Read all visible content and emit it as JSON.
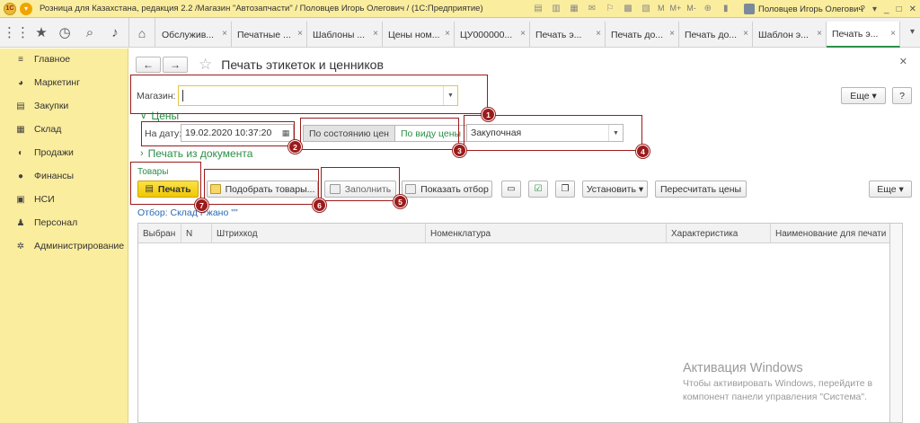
{
  "window": {
    "title": "Розница для Казахстана, редакция 2.2 /Магазин \"Автозапчасти\" / Половцев Игорь Олегович /  (1С:Предприятие)",
    "logo_text": "1С",
    "tools": [
      "M",
      "M+",
      "M-"
    ],
    "user": "Половцев Игорь Олегович",
    "controls": [
      "?",
      "▾",
      "_",
      "□",
      "✕"
    ]
  },
  "tabs": [
    {
      "label": "Обслужив...",
      "active": false
    },
    {
      "label": "Печатные ...",
      "active": false
    },
    {
      "label": "Шаблоны ...",
      "active": false
    },
    {
      "label": "Цены ном...",
      "active": false
    },
    {
      "label": "ЦУ000000...",
      "active": false
    },
    {
      "label": "Печать э...",
      "active": false
    },
    {
      "label": "Печать до...",
      "active": false
    },
    {
      "label": "Печать до...",
      "active": false
    },
    {
      "label": "Шаблон э...",
      "active": false
    },
    {
      "label": "Печать э...",
      "active": true
    }
  ],
  "sidebar": {
    "items": [
      {
        "label": "Главное",
        "icon": "menu-lines-icon"
      },
      {
        "label": "Маркетинг",
        "icon": "pie-chart-icon"
      },
      {
        "label": "Закупки",
        "icon": "cart-icon"
      },
      {
        "label": "Склад",
        "icon": "warehouse-icon"
      },
      {
        "label": "Продажи",
        "icon": "sales-icon"
      },
      {
        "label": "Финансы",
        "icon": "coins-icon"
      },
      {
        "label": "НСИ",
        "icon": "database-icon"
      },
      {
        "label": "Персонал",
        "icon": "person-icon"
      },
      {
        "label": "Администрирование",
        "icon": "gear-icon"
      }
    ]
  },
  "form": {
    "title": "Печать этикеток и ценников",
    "more_label": "Еще",
    "help_label": "?",
    "store_label": "Магазин:",
    "store_value": "",
    "prices_section": "Цены",
    "date_label": "На дату:",
    "date_value": "19.02.2020 10:37:20",
    "mode_by_state": "По состоянию цен",
    "mode_by_type": "По виду цены",
    "price_type_value": "Закупочная",
    "print_from_doc": "Печать из документа",
    "goods_group": "Товары",
    "toolbar": {
      "print": "Печать",
      "pick_goods": "Подобрать товары...",
      "fill": "Заполнить",
      "show_filter": "Показать отбор",
      "set": "Установить",
      "recalc": "Пересчитать цены",
      "more": "Еще"
    },
    "filter_text": "Отбор: Склад Ржано \"\"",
    "columns": [
      "Выбран",
      "N",
      "Штрихкод",
      "Номенклатура",
      "Характеристика",
      "Наименование для печати"
    ]
  },
  "annotations": [
    "1",
    "2",
    "3",
    "4",
    "5",
    "6",
    "7"
  ],
  "watermark": {
    "line1": "Активация Windows",
    "line2": "Чтобы активировать Windows, перейдите в",
    "line3": "компонент панели управления \"Система\"."
  },
  "colors": {
    "sidebar_bg": "#fbed9e",
    "accent_green": "#2b8f47",
    "annotation_red": "#9b1b1b",
    "print_button": "#f5d316"
  }
}
